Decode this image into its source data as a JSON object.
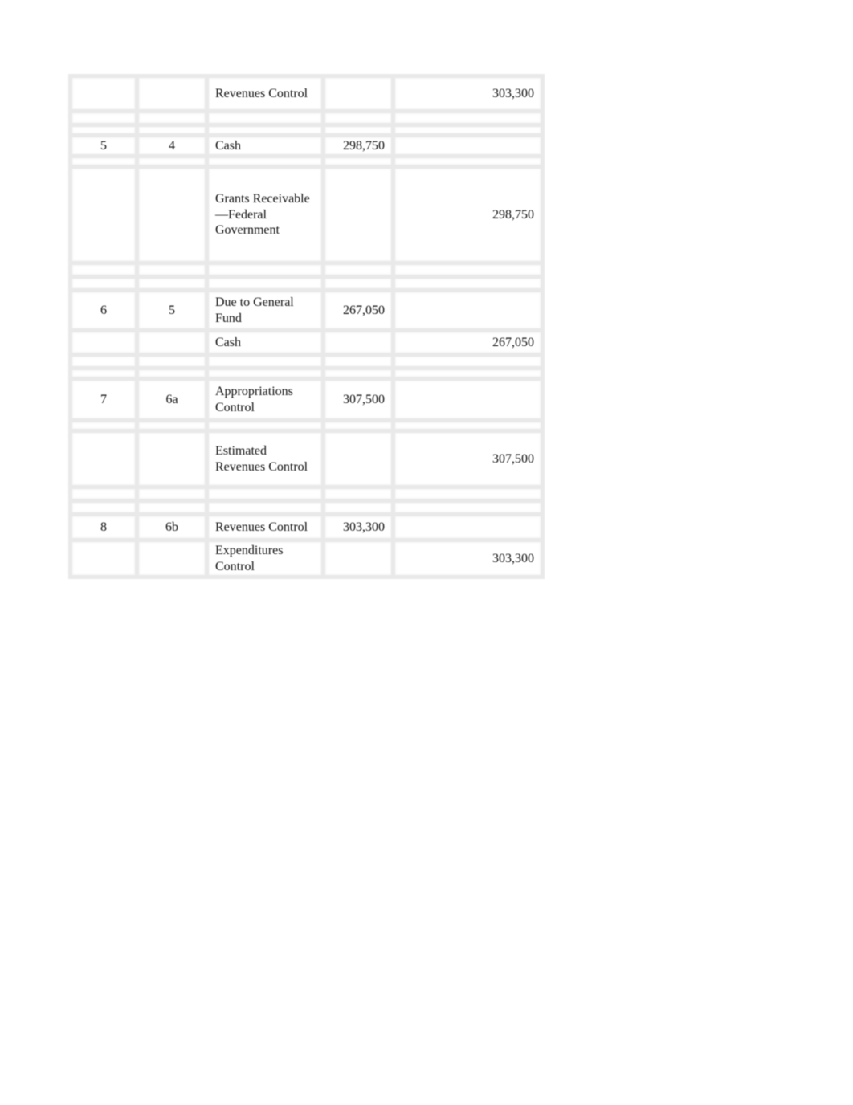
{
  "journal": {
    "rows": [
      {
        "entry": "",
        "transaction": "",
        "account": "Revenues Control",
        "debit": "",
        "credit": "303,300"
      },
      {
        "entry": "5",
        "transaction": "4",
        "account": "Cash",
        "debit": "298,750",
        "credit": ""
      },
      {
        "entry": "",
        "transaction": "",
        "account": "Grants Receivable—Federal Government",
        "debit": "",
        "credit": "298,750"
      },
      {
        "entry": "6",
        "transaction": "5",
        "account": "Due to General Fund",
        "debit": "267,050",
        "credit": ""
      },
      {
        "entry": "",
        "transaction": "",
        "account": "Cash",
        "debit": "",
        "credit": "267,050"
      },
      {
        "entry": "7",
        "transaction": "6a",
        "account": "Appropriations Control",
        "debit": "307,500",
        "credit": ""
      },
      {
        "entry": "",
        "transaction": "",
        "account": "Estimated Revenues Control",
        "debit": "",
        "credit": "307,500"
      },
      {
        "entry": "8",
        "transaction": "6b",
        "account": "Revenues Control",
        "debit": "303,300",
        "credit": ""
      },
      {
        "entry": "",
        "transaction": "",
        "account": "Expenditures Control",
        "debit": "",
        "credit": "303,300"
      }
    ]
  }
}
